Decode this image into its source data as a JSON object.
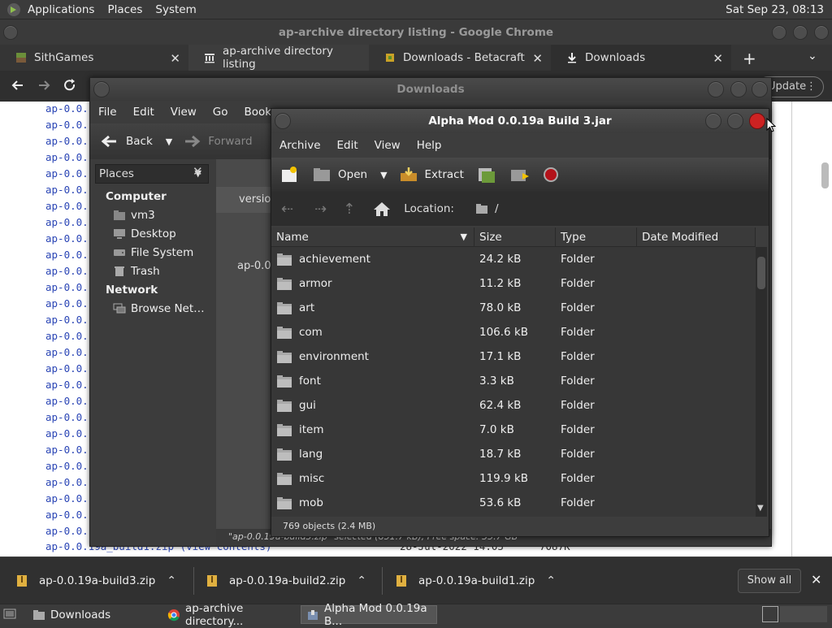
{
  "top_panel": {
    "menus": [
      "Applications",
      "Places",
      "System"
    ],
    "clock": "Sat Sep 23, 08:13"
  },
  "chrome": {
    "title": "ap-archive directory listing - Google Chrome",
    "tabs": [
      {
        "label": "SithGames",
        "icon": "grass-block-icon"
      },
      {
        "label": "ap-archive directory listing",
        "icon": "archive-building-icon"
      },
      {
        "label": "Downloads - Betacraft",
        "icon": "betacraft-icon"
      },
      {
        "label": "Downloads",
        "icon": "download-icon"
      }
    ],
    "update_label": "Update",
    "page_line_prefix": "ap-0.0.",
    "page_bottom_line": {
      "name": "ap-0.0.19a_build1.zip (view contents)",
      "date": "28-Jul-2022 14:05",
      "size": "7087K"
    }
  },
  "downloads_window": {
    "title": "Downloads",
    "menu": [
      "File",
      "Edit",
      "View",
      "Go",
      "Bookm"
    ],
    "back_label": "Back",
    "forward_label": "Forward",
    "places_label": "Places",
    "column_partial": "versio",
    "file_partial": "ap-0.0",
    "sections": [
      {
        "heading": "Computer",
        "items": [
          "vm3",
          "Desktop",
          "File System",
          "Trash"
        ]
      },
      {
        "heading": "Network",
        "items": [
          "Browse Net…"
        ]
      }
    ],
    "status": "\"ap-0.0.19a-build3.zip\" selected (851.7 kB), Free space: 35.7 GB"
  },
  "archive_window": {
    "title": "Alpha Mod 0.0.19a Build 3.jar",
    "menu": [
      "Archive",
      "Edit",
      "View",
      "Help"
    ],
    "toolbar": {
      "open": "Open",
      "extract": "Extract"
    },
    "location_label": "Location:",
    "location_value": "/",
    "columns": [
      "Name",
      "Size",
      "Type",
      "Date Modified"
    ],
    "rows": [
      {
        "name": "achievement",
        "size": "24.2 kB",
        "type": "Folder"
      },
      {
        "name": "armor",
        "size": "11.2 kB",
        "type": "Folder"
      },
      {
        "name": "art",
        "size": "78.0 kB",
        "type": "Folder"
      },
      {
        "name": "com",
        "size": "106.6 kB",
        "type": "Folder"
      },
      {
        "name": "environment",
        "size": "17.1 kB",
        "type": "Folder"
      },
      {
        "name": "font",
        "size": "3.3 kB",
        "type": "Folder"
      },
      {
        "name": "gui",
        "size": "62.4 kB",
        "type": "Folder"
      },
      {
        "name": "item",
        "size": "7.0 kB",
        "type": "Folder"
      },
      {
        "name": "lang",
        "size": "18.7 kB",
        "type": "Folder"
      },
      {
        "name": "misc",
        "size": "119.9 kB",
        "type": "Folder"
      },
      {
        "name": "mob",
        "size": "53.6 kB",
        "type": "Folder"
      }
    ],
    "status": "769 objects (2.4 MB)"
  },
  "download_bar": {
    "items": [
      "ap-0.0.19a-build3.zip",
      "ap-0.0.19a-build2.zip",
      "ap-0.0.19a-build1.zip"
    ],
    "show_all": "Show all"
  },
  "taskbar": {
    "items": [
      "Downloads",
      "ap-archive directory...",
      "Alpha Mod 0.0.19a B..."
    ]
  }
}
